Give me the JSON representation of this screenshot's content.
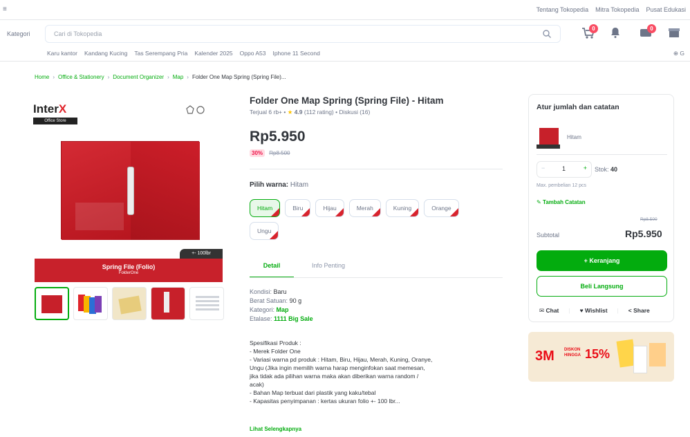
{
  "header": {
    "left_glyph": "≡",
    "top_links": [
      "Tentang Tokopedia",
      "Mitra Tokopedia",
      "Pusat Edukasi"
    ],
    "kategori_label": "Kategori",
    "search_placeholder": "Cari di Tokopedia",
    "cart_badge": "0",
    "notif_badge": "0",
    "suggestions": [
      "Karu kantor",
      "Kandang Kucing",
      "Tas Serempang Pria",
      "Kalender 2025",
      "Oppo A53",
      "Iphone 11 Second"
    ],
    "suggestion_right": "⊕ G"
  },
  "breadcrumb": {
    "items": [
      "Home",
      "Office & Stationery",
      "Document Organizer",
      "Map"
    ],
    "current": "Folder One Map Spring (Spring File)...",
    "separator": "›"
  },
  "gallery": {
    "brand_name_a": "Inter",
    "brand_name_b": "X",
    "brand_tag": "Office Store",
    "capacity_badge": "+- 100lbr",
    "band_title": "Spring File (Folio)",
    "band_sub": "FolderOne"
  },
  "product": {
    "title": "Folder One Map Spring (Spring File) - Hitam",
    "sold": "Terjual 6 rb+",
    "rating": "4.9",
    "rating_count": "(112 rating)",
    "discussion": "Diskusi (16)",
    "price": "Rp5.950",
    "discount_pct": "30%",
    "original_price": "Rp8.500",
    "color_label": "Pilih warna:",
    "color_selected": "Hitam",
    "variants": [
      "Hitam",
      "Biru",
      "Hijau",
      "Merah",
      "Kuning",
      "Orange",
      "Ungu"
    ],
    "selected_variant": "Hitam"
  },
  "tabs": {
    "detail": "Detail",
    "info": "Info Penting"
  },
  "specs": {
    "kondisi_label": "Kondisi:",
    "kondisi_val": "Baru",
    "berat_label": "Berat Satuan:",
    "berat_val": "90 g",
    "kategori_label": "Kategori:",
    "kategori_val": "Map",
    "etalase_label": "Etalase:",
    "etalase_val": "1111 Big Sale"
  },
  "description": {
    "lines": [
      "Spesifikasi Produk :",
      "- Merek Folder One",
      "- Variasi warna pd produk : Hitam, Biru, Hijau, Merah, Kuning, Oranye,",
      "Ungu (Jika ingin memilih warna harap menginfokan saat memesan,",
      "jika tidak ada pilihan warna maka akan diberikan warna random /",
      "acak)",
      "- Bahan Map terbuat dari plastik yang kaku/tebal",
      "- Kapasitas penyimpanan : kertas ukuran folio +- 100 lbr..."
    ],
    "more": "Lihat Selengkapnya"
  },
  "cart_card": {
    "title": "Atur jumlah dan catatan",
    "variant": "Hitam",
    "qty": "1",
    "stock_label": "Stok:",
    "stock": "40",
    "max_purchase": "Max. pembelian 12 pcs",
    "add_note": "Tambah Catatan",
    "subtotal_original": "Rp8.500",
    "subtotal_label": "Subtotal",
    "subtotal": "Rp5.950",
    "add_to_cart": "+ Keranjang",
    "buy_now": "Beli Langsung",
    "chat": "Chat",
    "wishlist": "Wishlist",
    "share": "Share"
  },
  "promo": {
    "brand": "3M",
    "line1": "DISKON",
    "line2": "HINGGA",
    "percent": "15%"
  },
  "colors": {
    "accent": "#03ac0e",
    "product_red": "#c7202a",
    "badge": "#f94d63"
  }
}
